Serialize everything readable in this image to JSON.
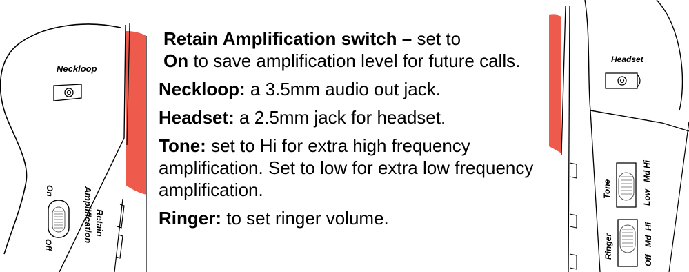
{
  "left_device": {
    "neckloop_label": "Neckloop",
    "retain_label_line1": "Retain",
    "retain_label_line2": "Amplification",
    "on_label": "On",
    "off_label": "Off"
  },
  "instructions": {
    "retain": {
      "term": "Retain Amplification switch –",
      "desc_part1": " set to ",
      "value": "On",
      "desc_part2": " to save amplification level for future calls."
    },
    "neckloop": {
      "term": "Neckloop:",
      "desc": " a 3.5mm audio out jack."
    },
    "headset": {
      "term": "Headset:",
      "desc": " a 2.5mm jack for headset."
    },
    "tone": {
      "term": "Tone:",
      "desc": " set to Hi for extra high frequency amplification. Set to low for extra low frequency amplification."
    },
    "ringer": {
      "term": "Ringer:",
      "desc": " to set ringer volume."
    }
  },
  "right_device": {
    "headset_label": "Headset",
    "tone_label": "Tone",
    "tone_low": "Low",
    "tone_md": "Md",
    "tone_hi": "Hi",
    "ringer_label": "Ringer",
    "ringer_off": "Off",
    "ringer_md": "Md",
    "ringer_hi": "Hi"
  },
  "colors": {
    "accent": "#ee5a4c",
    "line": "#000000"
  }
}
